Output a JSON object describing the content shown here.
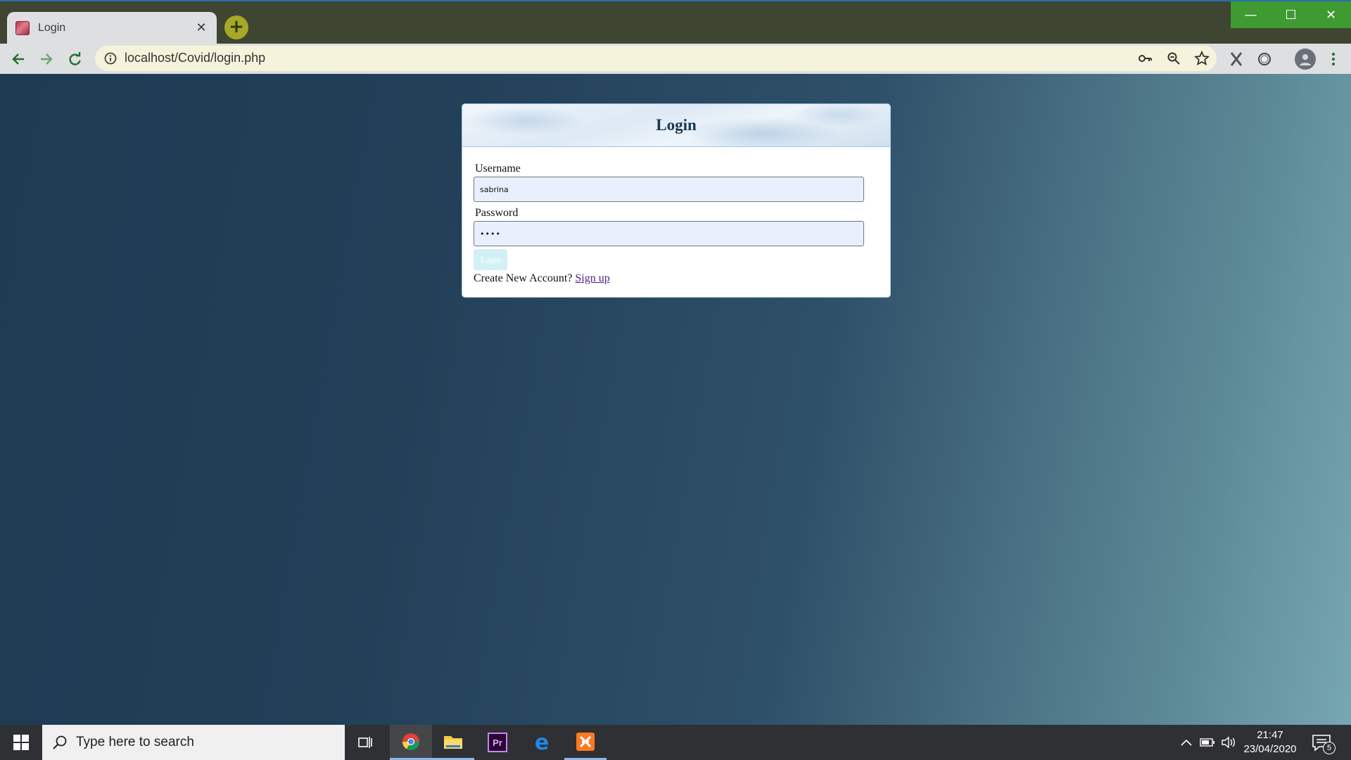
{
  "browser": {
    "tab_title": "Login",
    "tab_close": "✕",
    "new_tab": "+",
    "url": "localhost/Covid/login.php",
    "accent_color": "#3f9a32"
  },
  "window_controls": {
    "minimize": "—",
    "maximize": "☐",
    "close": "✕"
  },
  "login_form": {
    "title": "Login",
    "username_label": "Username",
    "username_value": "sabrina",
    "password_label": "Password",
    "password_value": "••••",
    "submit_label": "Login",
    "signup_prompt": "Create New Account?",
    "signup_link": "Sign up"
  },
  "taskbar": {
    "search_placeholder": "Type here to search",
    "time": "21:47",
    "date": "23/04/2020",
    "notification_count": "5",
    "apps": [
      "chrome-icon",
      "file-explorer-icon",
      "premiere-pro-icon",
      "edge-icon",
      "xampp-icon"
    ]
  }
}
